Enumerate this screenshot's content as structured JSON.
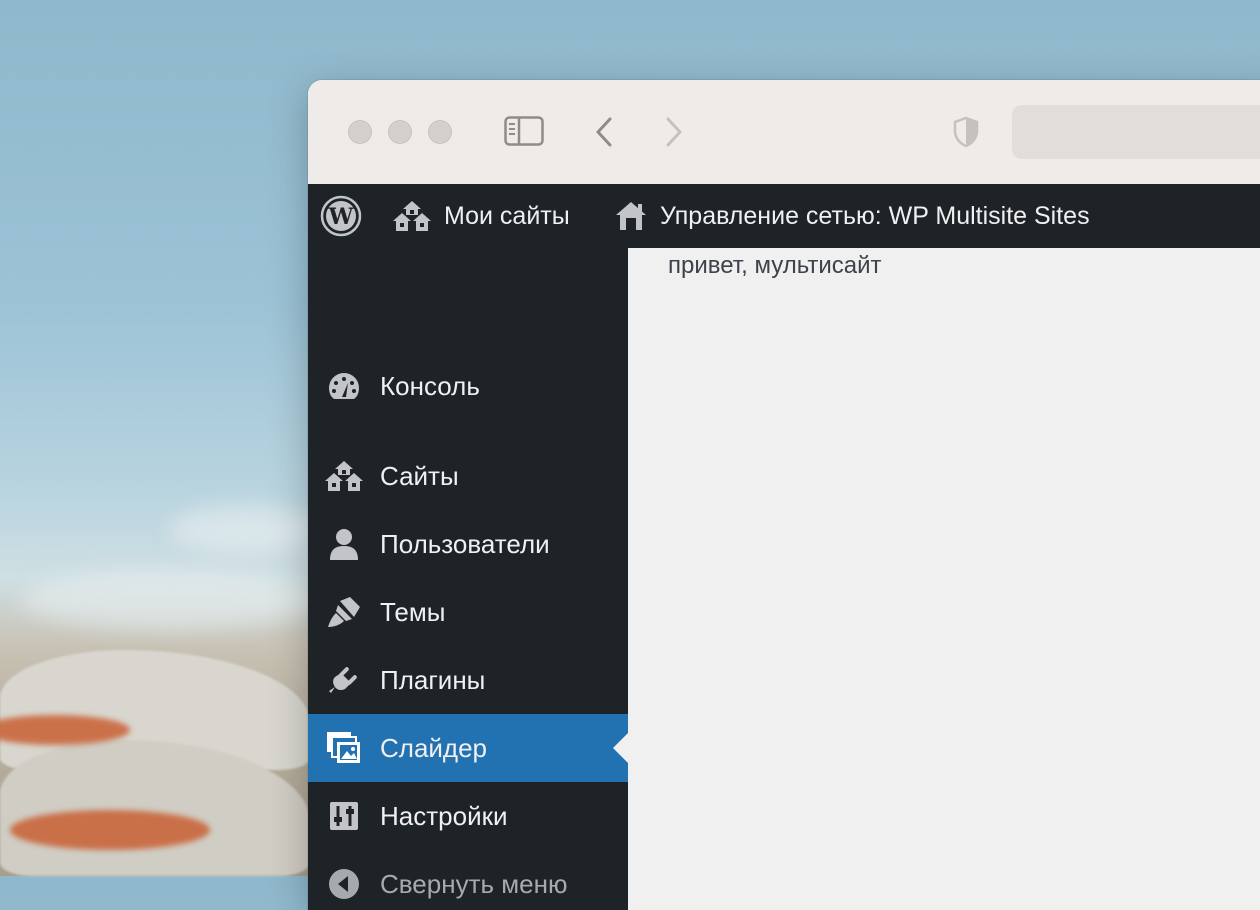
{
  "browser": {
    "icons": {
      "sidebar_toggle": "sidebar-icon",
      "back": "chevron-left-icon",
      "forward": "chevron-right-icon",
      "privacy": "shield-icon"
    }
  },
  "admin_bar": {
    "my_sites_label": "Мои сайты",
    "network_label": "Управление сетью: WP Multisite Sites"
  },
  "sidebar": {
    "items": [
      {
        "label": "Консоль",
        "icon": "dashboard-icon"
      },
      {
        "label": "Сайты",
        "icon": "sites-icon"
      },
      {
        "label": "Пользователи",
        "icon": "user-icon"
      },
      {
        "label": "Темы",
        "icon": "paintbrush-icon"
      },
      {
        "label": "Плагины",
        "icon": "plugin-icon"
      },
      {
        "label": "Слайдер",
        "icon": "images-icon",
        "current": true
      },
      {
        "label": "Настройки",
        "icon": "settings-icon"
      }
    ],
    "collapse_label": "Свернуть меню"
  },
  "content": {
    "text": "привет, мультисайт"
  },
  "colors": {
    "admin_dark": "#1d2327",
    "accent": "#2271b1",
    "content_bg": "#f0f0f1"
  }
}
